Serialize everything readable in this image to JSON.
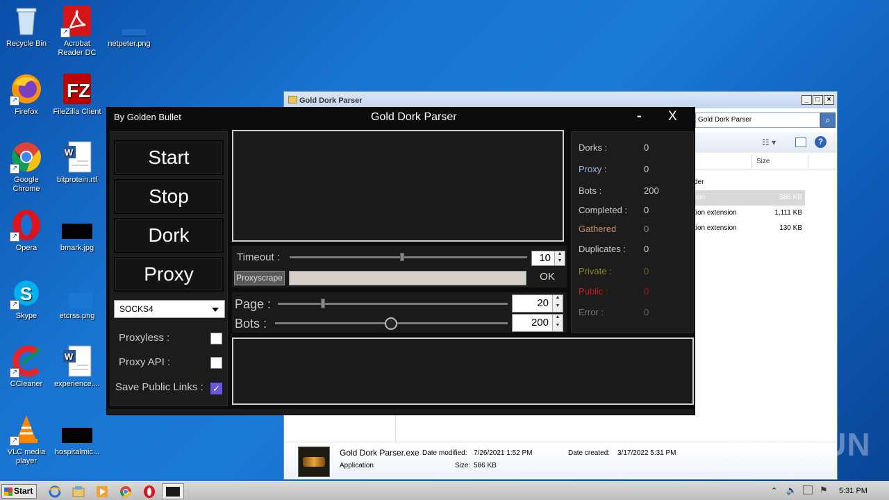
{
  "desktop": {
    "icons": [
      {
        "label": "Recycle Bin",
        "icon": "recycle-bin-icon"
      },
      {
        "label": "Acrobat Reader DC",
        "icon": "acrobat-icon"
      },
      {
        "label": "netpeter.png",
        "icon": "image-file-icon"
      },
      {
        "label": "Firefox",
        "icon": "firefox-icon"
      },
      {
        "label": "FileZilla Client",
        "icon": "filezilla-icon"
      },
      {
        "label": "Google Chrome",
        "icon": "chrome-icon"
      },
      {
        "label": "bitprotein.rtf",
        "icon": "word-doc-icon"
      },
      {
        "label": "Opera",
        "icon": "opera-icon"
      },
      {
        "label": "bmark.jpg",
        "icon": "image-file-icon"
      },
      {
        "label": "Skype",
        "icon": "skype-icon"
      },
      {
        "label": "etcrss.png",
        "icon": "image-file-icon"
      },
      {
        "label": "CCleaner",
        "icon": "ccleaner-icon"
      },
      {
        "label": "experience....",
        "icon": "word-doc-icon"
      },
      {
        "label": "VLC media player",
        "icon": "vlc-icon"
      },
      {
        "label": "hospitalmic...",
        "icon": "image-file-icon"
      }
    ]
  },
  "explorer": {
    "title": "Gold Dork Parser",
    "search_text": "Gold Dork Parser",
    "col_size": "Size",
    "rows": [
      {
        "type": "der",
        "size": ""
      },
      {
        "type": "tion",
        "size": "586 KB"
      },
      {
        "type": "tion extension",
        "size": "1,111 KB"
      },
      {
        "type": "tion extension",
        "size": "130 KB"
      }
    ],
    "details": {
      "name": "Gold Dork Parser.exe",
      "kind": "Application",
      "modified_label": "Date modified:",
      "modified": "7/26/2021 1:52 PM",
      "created_label": "Date created:",
      "created": "3/17/2022 5:31 PM",
      "size_label": "Size:",
      "size": "586 KB"
    }
  },
  "gdp": {
    "author": "By Golden Bullet",
    "title": "Gold Dork Parser",
    "minimize": "-",
    "close": "X",
    "buttons": {
      "start": "Start",
      "stop": "Stop",
      "dork": "Dork",
      "proxy": "Proxy"
    },
    "proxy_type": "SOCKS4",
    "options": {
      "proxyless": "Proxyless :",
      "proxy_api": "Proxy API :",
      "save_public": "Save Public Links :"
    },
    "save_public_checked": true,
    "timeout_label": "Timeout :",
    "timeout_value": "10",
    "proxyscrape_label": "Proxyscrape",
    "ok_label": "OK",
    "page_label": "Page :",
    "page_value": "20",
    "bots_label": "Bots :",
    "bots_value": "200",
    "stats": {
      "dorks_label": "Dorks :",
      "dorks": "0",
      "proxy_label": "Proxy :",
      "proxy": "0",
      "bots_label": "Bots :",
      "bots": "200",
      "completed_label": "Completed :",
      "completed": "0",
      "gathered_label": "Gathered",
      "gathered": "0",
      "duplicates_label": "Duplicates :",
      "duplicates": "0",
      "private_label": "Private :",
      "private": "0",
      "public_label": "Public :",
      "public": "0",
      "error_label": "Error :",
      "error": "0"
    },
    "colors": {
      "private": "#8a8a1a",
      "public": "#d41a1a",
      "gathered": "#c8906a",
      "proxy": "#9fb8e8",
      "error": "#777777"
    }
  },
  "taskbar": {
    "start": "Start",
    "time": "5:31 PM"
  },
  "watermark": "ANY RUN"
}
